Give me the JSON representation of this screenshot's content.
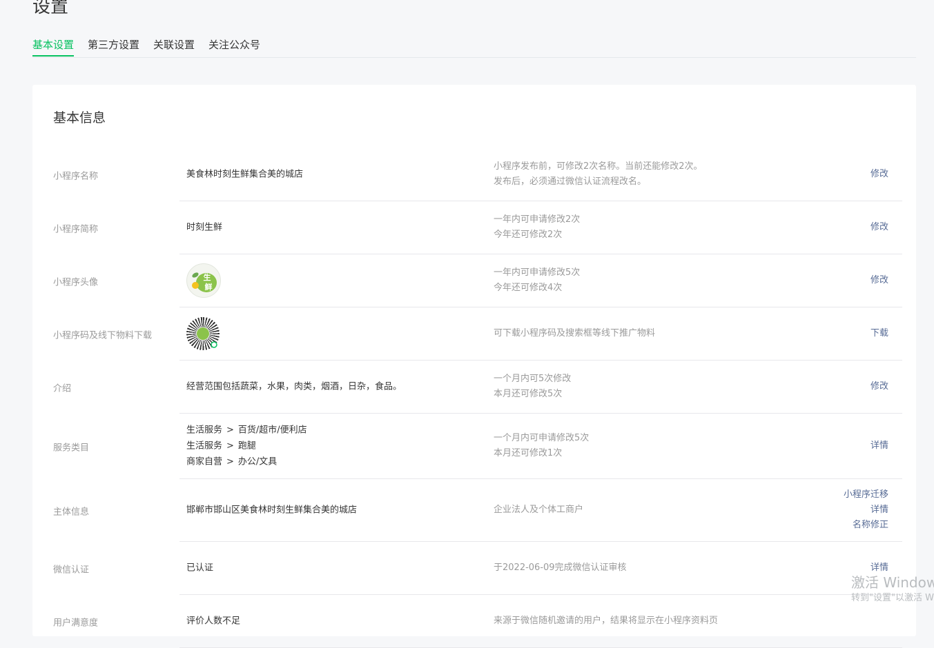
{
  "page_title": "设置",
  "tabs": [
    {
      "label": "基本设置",
      "active": true
    },
    {
      "label": "第三方设置",
      "active": false
    },
    {
      "label": "关联设置",
      "active": false
    },
    {
      "label": "关注公众号",
      "active": false
    }
  ],
  "card_title": "基本信息",
  "rows": {
    "name": {
      "label": "小程序名称",
      "value": "美食林时刻生鲜集合美的城店",
      "desc": [
        "小程序发布前，可修改2次名称。当前还能修改2次。",
        "发布后，必须通过微信认证流程改名。"
      ],
      "action": "修改"
    },
    "short_name": {
      "label": "小程序简称",
      "value": "时刻生鲜",
      "desc": [
        "一年内可申请修改2次",
        "今年还可修改2次"
      ],
      "action": "修改"
    },
    "avatar": {
      "label": "小程序头像",
      "image_text": [
        "生",
        "鲜"
      ],
      "desc": [
        "一年内可申请修改5次",
        "今年还可修改4次"
      ],
      "action": "修改"
    },
    "qrcode": {
      "label": "小程序码及线下物料下载",
      "desc": [
        "可下载小程序码及搜索框等线下推广物料"
      ],
      "action": "下载"
    },
    "intro": {
      "label": "介绍",
      "value": "经营范围包括蔬菜，水果，肉类，烟酒，日杂，食品。",
      "desc": [
        "一个月内可5次修改",
        "本月还可修改5次"
      ],
      "action": "修改"
    },
    "category": {
      "label": "服务类目",
      "items": [
        {
          "parent": "生活服务",
          "child": "百货/超市/便利店"
        },
        {
          "parent": "生活服务",
          "child": "跑腿"
        },
        {
          "parent": "商家自营",
          "child": "办公/文具"
        }
      ],
      "arrow": ">",
      "desc": [
        "一个月内可申请修改5次",
        "本月还可修改1次"
      ],
      "action": "详情"
    },
    "entity": {
      "label": "主体信息",
      "value": "邯郸市邯山区美食林时刻生鲜集合美的城店",
      "desc": [
        "企业法人及个体工商户"
      ],
      "actions": [
        "小程序迁移",
        "详情",
        "名称修正"
      ]
    },
    "verify": {
      "label": "微信认证",
      "value": "已认证",
      "desc": [
        "于2022-06-09完成微信认证审核"
      ],
      "action": "详情"
    },
    "satisfaction": {
      "label": "用户满意度",
      "value": "评价人数不足",
      "desc": [
        "来源于微信随机邀请的用户，结果将显示在小程序资料页"
      ]
    }
  },
  "watermark": {
    "line1": "激活 Windows",
    "line2": "转到\"设置\"以激活 Windows。"
  },
  "colors": {
    "accent": "#07c160",
    "link": "#576b95",
    "muted": "#9a9a9a"
  }
}
